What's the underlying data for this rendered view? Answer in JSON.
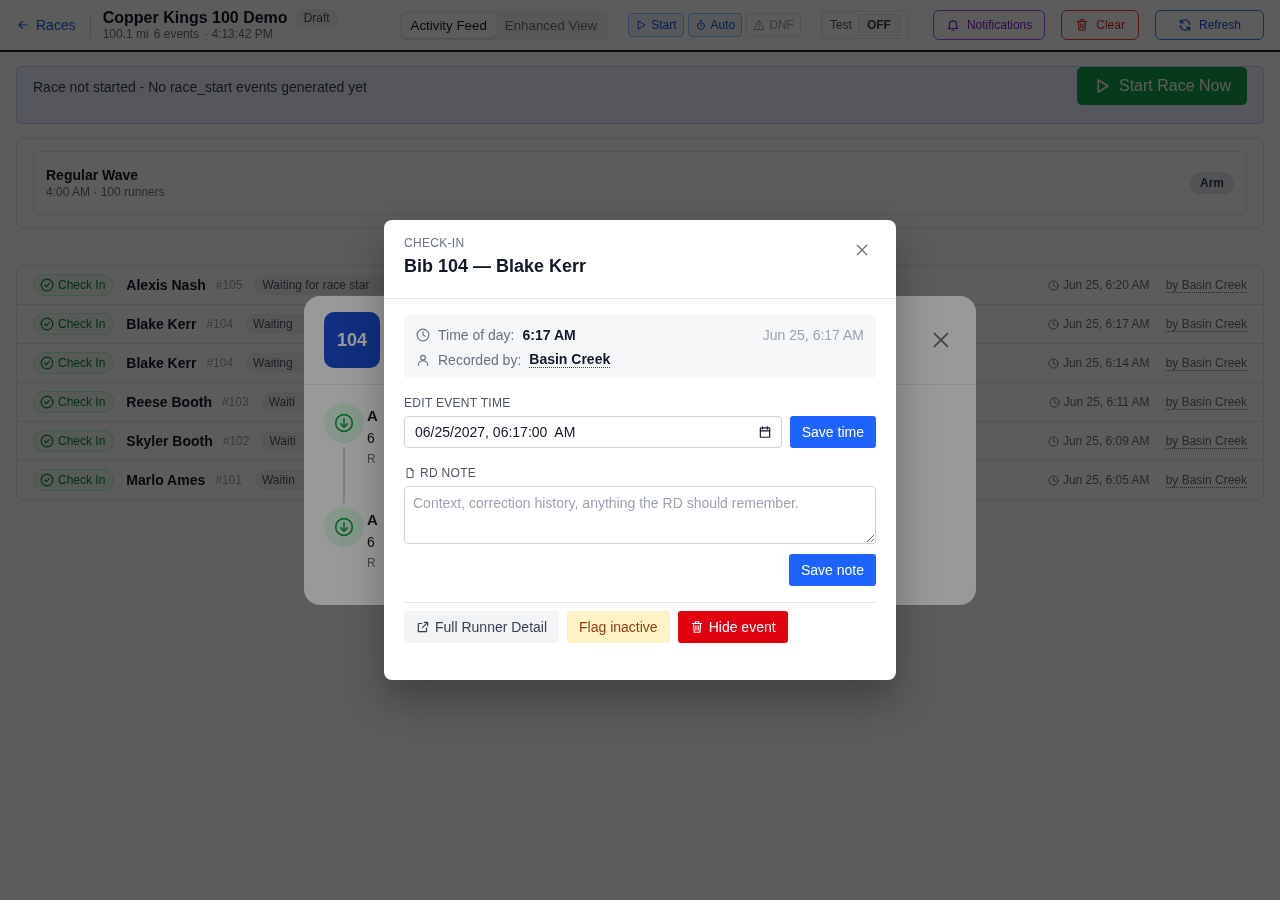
{
  "header": {
    "back_link": "Races",
    "title": "Copper Kings 100 Demo",
    "status_badge": "Draft",
    "meta": [
      "100.1 mi",
      "6 events",
      "· 4:13:42 PM"
    ],
    "view_tabs": [
      {
        "label": "Activity Feed",
        "selected": true
      },
      {
        "label": "Enhanced View",
        "selected": false
      }
    ],
    "race_controls": [
      {
        "label": "Start",
        "kind": "start",
        "disabled": false
      },
      {
        "label": "Auto",
        "kind": "auto",
        "disabled": false
      },
      {
        "label": "DNF",
        "kind": "dnf",
        "disabled": true
      }
    ],
    "test_toggle": {
      "label": "Test",
      "value": "OFF",
      "on": false
    },
    "actions": [
      {
        "label": "Notifications",
        "kind": "notifications"
      },
      {
        "label": "Clear",
        "kind": "clear"
      },
      {
        "label": "Refresh",
        "kind": "refresh"
      }
    ]
  },
  "banner": {
    "message": "Race not started - No race_start events generated yet",
    "button": "Start Race Now"
  },
  "waves": [
    {
      "name": "Regular Wave",
      "detail": "4:00 AM · 100 runners",
      "button": "Arm"
    }
  ],
  "feed": [
    {
      "type": "Check In",
      "name": "Alexis Nash",
      "bib": "#105",
      "status": "Waiting for race star",
      "time": "Jun 25, 6:20 AM",
      "recorded_by": "by Basin Creek"
    },
    {
      "type": "Check In",
      "name": "Blake Kerr",
      "bib": "#104",
      "status": "Waiting",
      "time": "Jun 25, 6:17 AM",
      "recorded_by": "by Basin Creek"
    },
    {
      "type": "Check In",
      "name": "Blake Kerr",
      "bib": "#104",
      "status": "Waiting",
      "time": "Jun 25, 6:14 AM",
      "recorded_by": "by Basin Creek"
    },
    {
      "type": "Check In",
      "name": "Reese Booth",
      "bib": "#103",
      "status": "Waiti",
      "time": "Jun 25, 6:11 AM",
      "recorded_by": "by Basin Creek"
    },
    {
      "type": "Check In",
      "name": "Skyler Booth",
      "bib": "#102",
      "status": "Waiti",
      "time": "Jun 25, 6:09 AM",
      "recorded_by": "by Basin Creek"
    },
    {
      "type": "Check In",
      "name": "Marlo Ames",
      "bib": "#101",
      "status": "Waitin",
      "time": "Jun 25, 6:05 AM",
      "recorded_by": "by Basin Creek"
    }
  ],
  "runner_panel": {
    "bib": "104",
    "timeline": [
      {
        "title": "A",
        "time": "6",
        "note": "R"
      },
      {
        "title": "A",
        "time": "6",
        "note": "R"
      }
    ]
  },
  "dialog": {
    "eyebrow": "CHECK-IN",
    "title": "Bib 104 — Blake Kerr",
    "time_of_day_label": "Time of day:",
    "time_of_day": "6:17 AM",
    "timestamp": "Jun 25, 6:17 AM",
    "recorded_by_label": "Recorded by:",
    "recorded_by": "Basin Creek",
    "edit_time_label": "EDIT EVENT TIME",
    "edit_time_value": "06/25/2027, 06:17:00  AM",
    "save_time": "Save time",
    "note_label": "RD NOTE",
    "note_placeholder": "Context, correction history, anything the RD should remember.",
    "save_note": "Save note",
    "footer_buttons": [
      {
        "label": "Full Runner Detail",
        "kind": "detail"
      },
      {
        "label": "Flag inactive",
        "kind": "flag"
      },
      {
        "label": "Hide event",
        "kind": "hide"
      }
    ]
  }
}
